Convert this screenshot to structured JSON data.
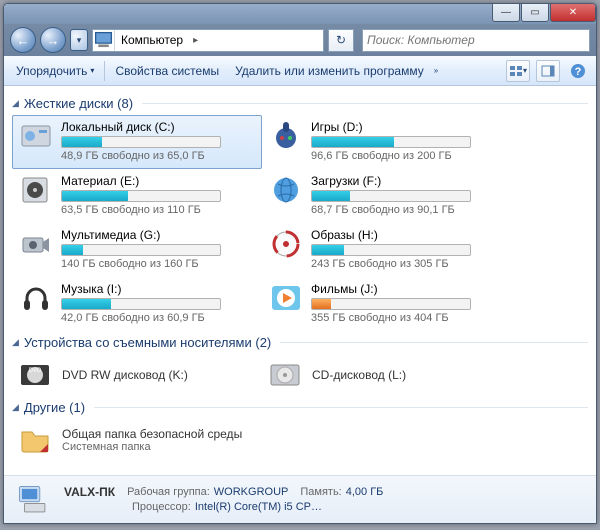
{
  "titlebar": {
    "min": "—",
    "max": "▭",
    "close": "✕"
  },
  "nav": {
    "back": "←",
    "forward": "→",
    "recent": "▾",
    "refresh": "↻",
    "breadcrumb_label": "Компьютер",
    "breadcrumb_arrow": "▸"
  },
  "search": {
    "placeholder": "Поиск: Компьютер"
  },
  "toolbar": {
    "organize": "Упорядочить",
    "down": "▾",
    "props": "Свойства системы",
    "uninstall": "Удалить или изменить программу",
    "chev": "»"
  },
  "groups": {
    "hdd": "Жесткие диски (8)",
    "removable": "Устройства со съемными носителями (2)",
    "other": "Другие (1)"
  },
  "drives": [
    {
      "name": "Локальный диск (C:)",
      "free": "48,9 ГБ свободно из 65,0 ГБ",
      "pct": 25,
      "warn": false,
      "icon": "hdd"
    },
    {
      "name": "Игры (D:)",
      "free": "96,6 ГБ свободно из 200 ГБ",
      "pct": 52,
      "warn": false,
      "icon": "game"
    },
    {
      "name": "Материал (E:)",
      "free": "63,5 ГБ свободно из 110 ГБ",
      "pct": 42,
      "warn": false,
      "icon": "album"
    },
    {
      "name": "Загрузки (F:)",
      "free": "68,7 ГБ свободно из 90,1 ГБ",
      "pct": 24,
      "warn": false,
      "icon": "globe"
    },
    {
      "name": "Мультимедиа (G:)",
      "free": "140 ГБ свободно из 160 ГБ",
      "pct": 13,
      "warn": false,
      "icon": "camera"
    },
    {
      "name": "Образы (H:)",
      "free": "243 ГБ свободно из 305 ГБ",
      "pct": 20,
      "warn": false,
      "icon": "disc"
    },
    {
      "name": "Музыка (I:)",
      "free": "42,0 ГБ свободно из 60,9 ГБ",
      "pct": 31,
      "warn": false,
      "icon": "phones"
    },
    {
      "name": "Фильмы (J:)",
      "free": "355 ГБ свободно из 404 ГБ",
      "pct": 12,
      "warn": true,
      "icon": "play"
    }
  ],
  "removable": [
    {
      "name": "DVD RW дисковод (K:)",
      "icon": "dvd"
    },
    {
      "name": "CD-дисковод (L:)",
      "icon": "cd"
    }
  ],
  "other": [
    {
      "name": "Общая папка безопасной среды",
      "sub": "Системная папка",
      "icon": "folder"
    }
  ],
  "details": {
    "pcname": "VALX-ПК",
    "workgroup_lbl": "Рабочая группа:",
    "workgroup_val": "WORKGROUP",
    "mem_lbl": "Память:",
    "mem_val": "4,00 ГБ",
    "cpu_lbl": "Процессор:",
    "cpu_val": "Intel(R) Core(TM) i5 CP…"
  }
}
